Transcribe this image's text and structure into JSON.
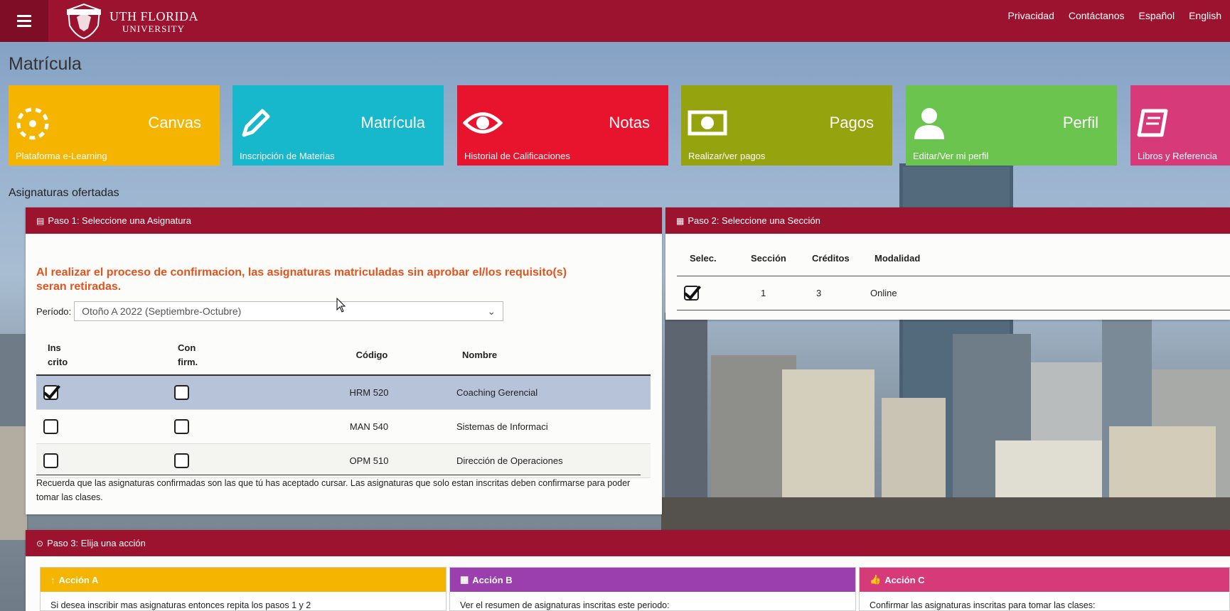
{
  "topbar": {
    "logo_line1": "UTH FLORIDA",
    "logo_line2": "UNIVERSITY",
    "nav": [
      "Privacidad",
      "Contáctanos",
      "Español",
      "English"
    ]
  },
  "page_title": "Matrícula",
  "tiles": [
    {
      "name": "Canvas",
      "sub": "Plataforma e-Learning",
      "icon": "canvas-icon",
      "color": "#f4b400"
    },
    {
      "name": "Matrícula",
      "sub": "Inscripción de Materias",
      "icon": "pencil-icon",
      "color": "#17b7cc"
    },
    {
      "name": "Notas",
      "sub": "Historial de Calificaciones",
      "icon": "eye-icon",
      "color": "#e8132d"
    },
    {
      "name": "Pagos",
      "sub": "Realizar/ver pagos",
      "icon": "money-icon",
      "color": "#94a30e"
    },
    {
      "name": "Perfil",
      "sub": "Editar/Ver mi perfil",
      "icon": "user-icon",
      "color": "#6bc44d"
    },
    {
      "name": "",
      "sub": "Libros y Referencia",
      "icon": "book-icon",
      "color": "#d63a78"
    }
  ],
  "section_title": "Asignaturas ofertadas",
  "step1": {
    "title": "Paso 1: Seleccione una Asignatura",
    "warning": "Al realizar el proceso de confirmacion, las asignaturas matriculadas sin aprobar el/los requisito(s) seran retiradas.",
    "period_label": "Período:",
    "period_value": "Otoño A 2022 (Septiembre-Octubre)",
    "headers": {
      "inscrito": "Ins crito",
      "confirm": "Con firm.",
      "codigo": "Código",
      "nombre": "Nombre"
    },
    "rows": [
      {
        "inscrito": true,
        "confirmado": false,
        "codigo": "HRM 520",
        "nombre": "Coaching Gerencial"
      },
      {
        "inscrito": false,
        "confirmado": false,
        "codigo": "MAN 540",
        "nombre": "Sistemas de Informaci"
      },
      {
        "inscrito": false,
        "confirmado": false,
        "codigo": "OPM 510",
        "nombre": "Dirección de Operaciones"
      }
    ],
    "note": "Recuerda que las asignaturas confirmadas son las que tú has aceptado cursar. Las asignaturas que solo estan inscritas deben confirmarse para poder tomar las clases."
  },
  "step2": {
    "title": "Paso 2: Seleccione una Sección",
    "headers": {
      "sel": "Selec.",
      "seccion": "Sección",
      "creditos": "Créditos",
      "modalidad": "Modalidad"
    },
    "rows": [
      {
        "selected": true,
        "seccion": "1",
        "creditos": "3",
        "modalidad": "Online"
      }
    ]
  },
  "step3": {
    "title": "Paso 3: Elija una acción",
    "actions": [
      {
        "title": "Acción A",
        "text": "Si desea inscribir mas asignaturas entonces repita los pasos 1 y 2",
        "color": "#f4b400"
      },
      {
        "title": "Acción B",
        "text": "Ver el resumen de asignaturas inscritas este periodo:",
        "color": "#9b3fae"
      },
      {
        "title": "Acción C",
        "text": "Confirmar las asignaturas inscritas para tomar las clases:",
        "color": "#d63a78"
      }
    ]
  }
}
